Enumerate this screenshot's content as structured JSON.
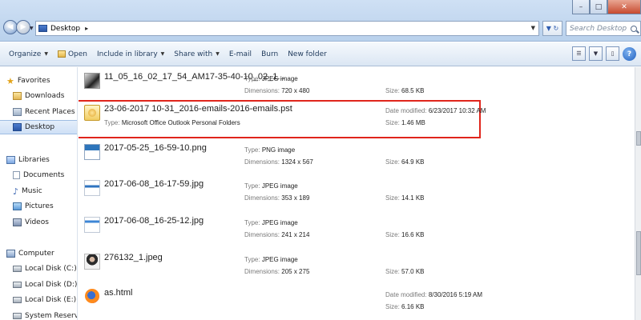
{
  "address": {
    "location": "Desktop",
    "search_placeholder": "Search Desktop"
  },
  "window_controls": [
    "–",
    "□",
    "✕"
  ],
  "toolbar": {
    "organize": "Organize",
    "open": "Open",
    "include_in_library": "Include in library",
    "share_with": "Share with",
    "email": "E-mail",
    "burn": "Burn",
    "new_folder": "New folder",
    "help": "?"
  },
  "nav": {
    "favorites": "Favorites",
    "downloads": "Downloads",
    "recent_places": "Recent Places",
    "desktop": "Desktop",
    "libraries": "Libraries",
    "documents": "Documents",
    "music": "Music",
    "pictures": "Pictures",
    "videos": "Videos",
    "computer": "Computer",
    "local_c": "Local Disk (C:)",
    "local_d": "Local Disk (D:)",
    "local_e": "Local Disk (E:)",
    "system_reserved": "System Reserved (I:)"
  },
  "files": [
    {
      "name": "11_05_16_02_17_54_AM17-35-40-10_02_1...",
      "type_label": "Type:",
      "type": "JPEG image",
      "dim_label": "Dimensions:",
      "dim": "720 x 480",
      "size_label": "Size:",
      "size": "68.5 KB"
    },
    {
      "name": "23-06-2017 10-31_2016-emails-2016-emails.pst",
      "type_label": "Type:",
      "type": "Microsoft Office Outlook Personal Folders",
      "date_label": "Date modified:",
      "date": "6/23/2017 10:32 AM",
      "size_label": "Size:",
      "size": "1.46 MB"
    },
    {
      "name": "2017-05-25_16-59-10.png",
      "type_label": "Type:",
      "type": "PNG image",
      "dim_label": "Dimensions:",
      "dim": "1324 x 567",
      "size_label": "Size:",
      "size": "64.9 KB"
    },
    {
      "name": "2017-06-08_16-17-59.jpg",
      "type_label": "Type:",
      "type": "JPEG image",
      "dim_label": "Dimensions:",
      "dim": "353 x 189",
      "size_label": "Size:",
      "size": "14.1 KB"
    },
    {
      "name": "2017-06-08_16-25-12.jpg",
      "type_label": "Type:",
      "type": "JPEG image",
      "dim_label": "Dimensions:",
      "dim": "241 x 214",
      "size_label": "Size:",
      "size": "16.6 KB"
    },
    {
      "name": "276132_1.jpeg",
      "type_label": "Type:",
      "type": "JPEG image",
      "dim_label": "Dimensions:",
      "dim": "205 x 275",
      "size_label": "Size:",
      "size": "57.0 KB"
    },
    {
      "name": "as.html",
      "date_label": "Date modified:",
      "date": "8/30/2016 5:19 AM",
      "size_label": "Size:",
      "size": "6.16 KB"
    }
  ]
}
